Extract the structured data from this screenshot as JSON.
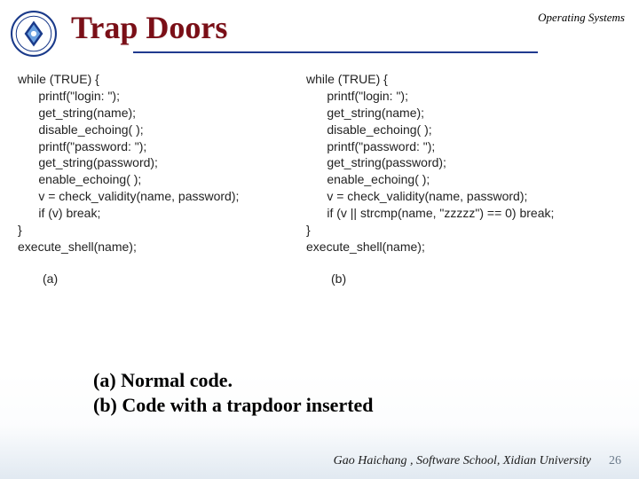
{
  "header": {
    "title": "Trap Doors",
    "top_right": "Operating Systems"
  },
  "code": {
    "a": "while (TRUE) {\n      printf(\"login: \");\n      get_string(name);\n      disable_echoing( );\n      printf(\"password: \");\n      get_string(password);\n      enable_echoing( );\n      v = check_validity(name, password);\n      if (v) break;\n}\nexecute_shell(name);",
    "a_label": "(a)",
    "b": "while (TRUE) {\n      printf(\"login: \");\n      get_string(name);\n      disable_echoing( );\n      printf(\"password: \");\n      get_string(password);\n      enable_echoing( );\n      v = check_validity(name, password);\n      if (v || strcmp(name, \"zzzzz\") == 0) break;\n}\nexecute_shell(name);",
    "b_label": "(b)"
  },
  "captions": {
    "a": "(a) Normal code.",
    "b": "(b) Code with a trapdoor inserted"
  },
  "footer": {
    "credit": "Gao Haichang , Software School, Xidian University",
    "slide_number": "26"
  }
}
